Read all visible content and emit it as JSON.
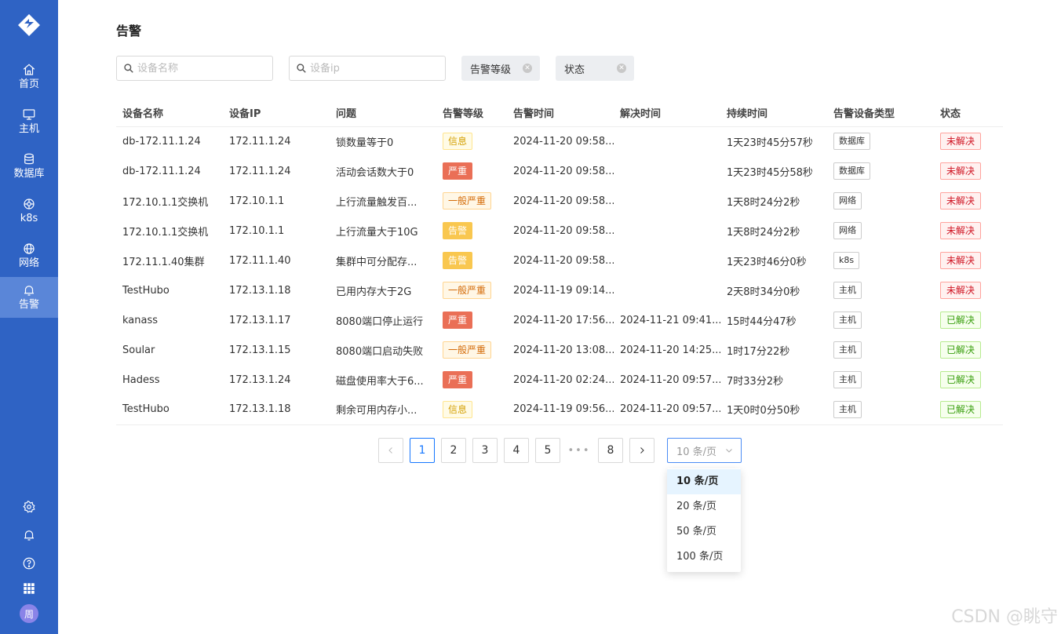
{
  "nav": {
    "items": [
      {
        "label": "首页",
        "icon": "home-icon"
      },
      {
        "label": "主机",
        "icon": "monitor-icon"
      },
      {
        "label": "数据库",
        "icon": "database-icon"
      },
      {
        "label": "k8s",
        "icon": "k8s-icon"
      },
      {
        "label": "网络",
        "icon": "globe-icon"
      },
      {
        "label": "告警",
        "icon": "bell-icon"
      }
    ],
    "active": "告警",
    "avatar": "周"
  },
  "page": {
    "title": "告警"
  },
  "filters": {
    "device_name_placeholder": "设备名称",
    "device_ip_placeholder": "设备ip",
    "level_label": "告警等级",
    "status_label": "状态"
  },
  "table": {
    "columns": [
      "设备名称",
      "设备IP",
      "问题",
      "告警等级",
      "告警时间",
      "解决时间",
      "持续时间",
      "告警设备类型",
      "状态"
    ],
    "rows": [
      {
        "name": "db-172.11.1.24",
        "ip": "172.11.1.24",
        "problem": "锁数量等于0",
        "level": "信息",
        "level_class": "lv-info",
        "alert_time": "2024-11-20 09:58...",
        "resolve_time": "",
        "duration": "1天23时45分57秒",
        "type": "数据库",
        "status": "未解决",
        "status_class": "st-unres"
      },
      {
        "name": "db-172.11.1.24",
        "ip": "172.11.1.24",
        "problem": "活动会话数大于0",
        "level": "严重",
        "level_class": "lv-severe",
        "alert_time": "2024-11-20 09:58...",
        "resolve_time": "",
        "duration": "1天23时45分58秒",
        "type": "数据库",
        "status": "未解决",
        "status_class": "st-unres"
      },
      {
        "name": "172.10.1.1交换机",
        "ip": "172.10.1.1",
        "problem": "上行流量触发百...",
        "level": "一般严重",
        "level_class": "lv-general",
        "alert_time": "2024-11-20 09:58...",
        "resolve_time": "",
        "duration": "1天8时24分2秒",
        "type": "网络",
        "status": "未解决",
        "status_class": "st-unres"
      },
      {
        "name": "172.10.1.1交换机",
        "ip": "172.10.1.1",
        "problem": "上行流量大于10G",
        "level": "告警",
        "level_class": "lv-warn",
        "alert_time": "2024-11-20 09:58...",
        "resolve_time": "",
        "duration": "1天8时24分2秒",
        "type": "网络",
        "status": "未解决",
        "status_class": "st-unres"
      },
      {
        "name": "172.11.1.40集群",
        "ip": "172.11.1.40",
        "problem": "集群中可分配存...",
        "level": "告警",
        "level_class": "lv-warn",
        "alert_time": "2024-11-20 09:58...",
        "resolve_time": "",
        "duration": "1天23时46分0秒",
        "type": "k8s",
        "status": "未解决",
        "status_class": "st-unres"
      },
      {
        "name": "TestHubo",
        "ip": "172.13.1.18",
        "problem": "已用内存大于2G",
        "level": "一般严重",
        "level_class": "lv-general",
        "alert_time": "2024-11-19 09:14...",
        "resolve_time": "",
        "duration": "2天8时34分0秒",
        "type": "主机",
        "status": "未解决",
        "status_class": "st-unres"
      },
      {
        "name": "kanass",
        "ip": "172.13.1.17",
        "problem": "8080端口停止运行",
        "level": "严重",
        "level_class": "lv-severe",
        "alert_time": "2024-11-20 17:56...",
        "resolve_time": "2024-11-21 09:41...",
        "duration": "15时44分47秒",
        "type": "主机",
        "status": "已解决",
        "status_class": "st-res"
      },
      {
        "name": "Soular",
        "ip": "172.13.1.15",
        "problem": "8080端口启动失败",
        "level": "一般严重",
        "level_class": "lv-general",
        "alert_time": "2024-11-20 13:08...",
        "resolve_time": "2024-11-20 14:25...",
        "duration": "1时17分22秒",
        "type": "主机",
        "status": "已解决",
        "status_class": "st-res"
      },
      {
        "name": "Hadess",
        "ip": "172.13.1.24",
        "problem": "磁盘使用率大于6...",
        "level": "严重",
        "level_class": "lv-severe",
        "alert_time": "2024-11-20 02:24...",
        "resolve_time": "2024-11-20 09:57...",
        "duration": "7时33分2秒",
        "type": "主机",
        "status": "已解决",
        "status_class": "st-res"
      },
      {
        "name": "TestHubo",
        "ip": "172.13.1.18",
        "problem": "剩余可用内存小...",
        "level": "信息",
        "level_class": "lv-info",
        "alert_time": "2024-11-19 09:56...",
        "resolve_time": "2024-11-20 09:57...",
        "duration": "1天0时0分50秒",
        "type": "主机",
        "status": "已解决",
        "status_class": "st-res"
      }
    ]
  },
  "pagination": {
    "pages": [
      "1",
      "2",
      "3",
      "4",
      "5"
    ],
    "ellipsis": "•••",
    "last": "8",
    "current": "1",
    "page_size_value": "10 条/页",
    "page_size_options": [
      "10 条/页",
      "20 条/页",
      "50 条/页",
      "100 条/页"
    ]
  },
  "watermark": "CSDN @眺守",
  "colors": {
    "sidebar": "#2f63c4",
    "accent": "#1677ff"
  }
}
